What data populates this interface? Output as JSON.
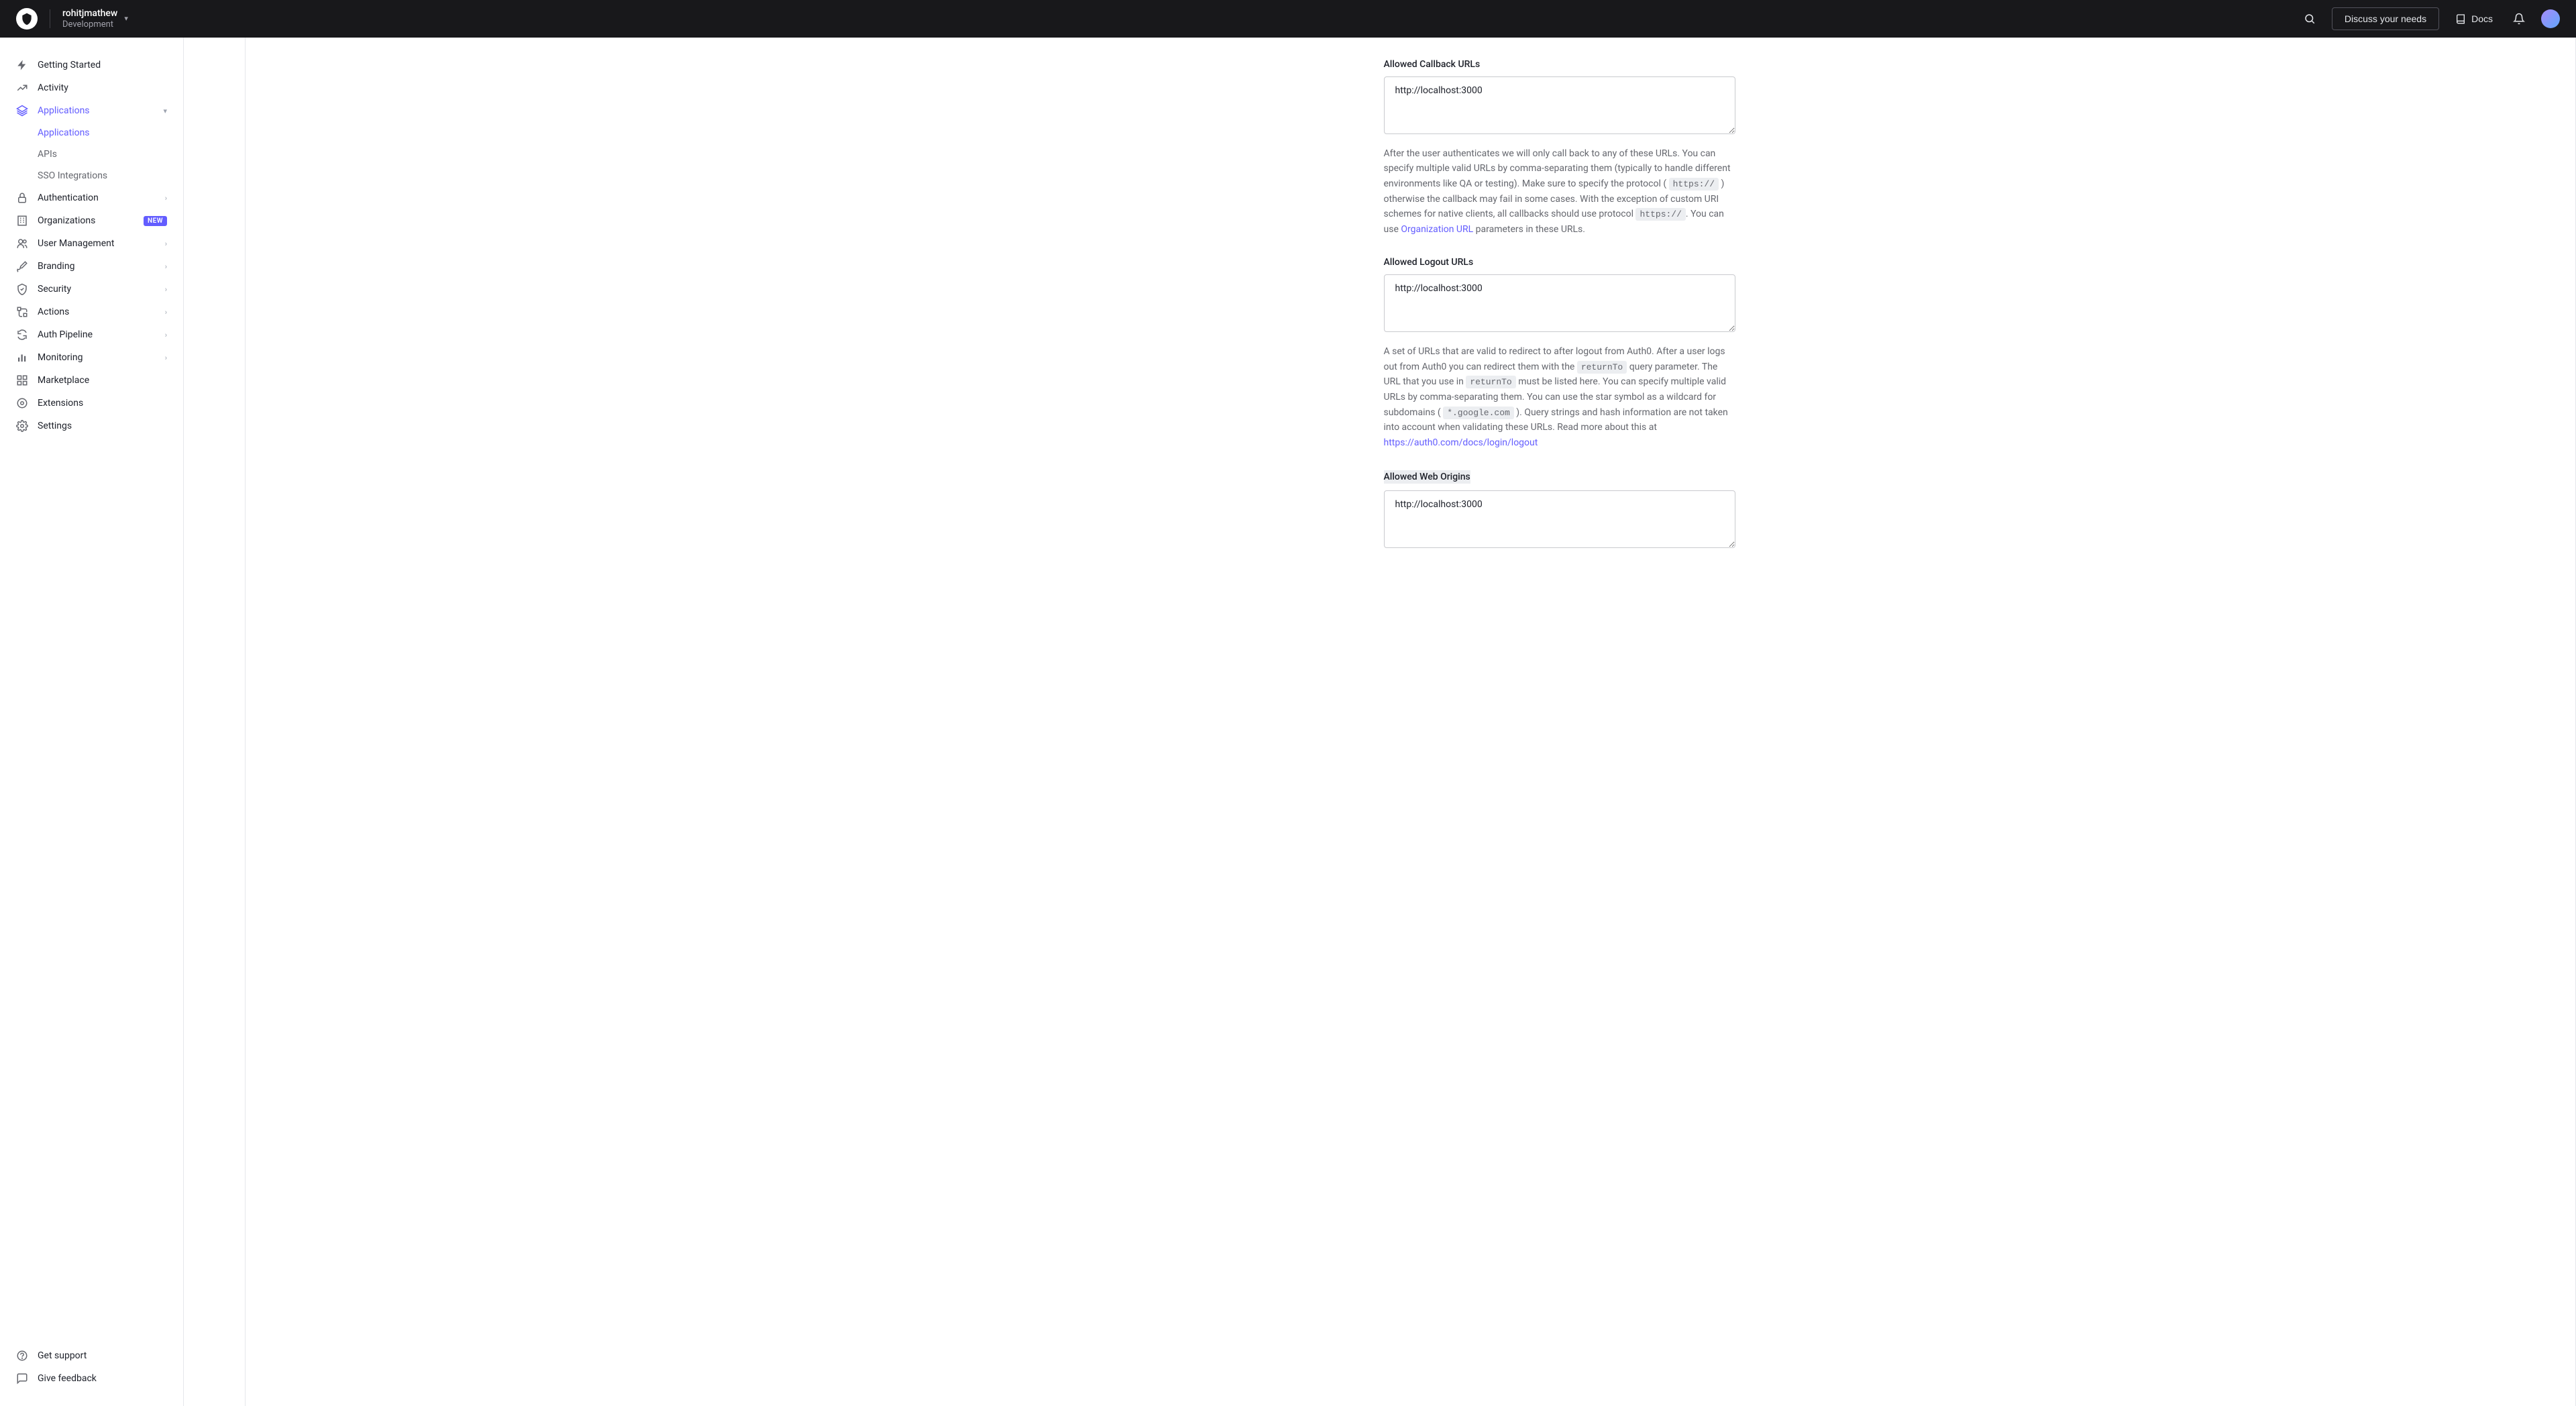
{
  "header": {
    "tenant_name": "rohitjmathew",
    "tenant_env": "Development",
    "discuss_label": "Discuss your needs",
    "docs_label": "Docs"
  },
  "sidebar": {
    "items": [
      {
        "label": "Getting Started",
        "icon": "lightning"
      },
      {
        "label": "Activity",
        "icon": "chart"
      },
      {
        "label": "Applications",
        "icon": "layers",
        "active": true,
        "expanded": true
      },
      {
        "label": "Authentication",
        "icon": "lock",
        "chevron": true
      },
      {
        "label": "Organizations",
        "icon": "building",
        "badge": "NEW"
      },
      {
        "label": "User Management",
        "icon": "users",
        "chevron": true
      },
      {
        "label": "Branding",
        "icon": "brush",
        "chevron": true
      },
      {
        "label": "Security",
        "icon": "shield",
        "chevron": true
      },
      {
        "label": "Actions",
        "icon": "flow",
        "chevron": true
      },
      {
        "label": "Auth Pipeline",
        "icon": "pipeline",
        "chevron": true
      },
      {
        "label": "Monitoring",
        "icon": "bars",
        "chevron": true
      },
      {
        "label": "Marketplace",
        "icon": "grid"
      },
      {
        "label": "Extensions",
        "icon": "puzzle"
      },
      {
        "label": "Settings",
        "icon": "gear"
      }
    ],
    "sub_items": [
      {
        "label": "Applications",
        "active": true
      },
      {
        "label": "APIs"
      },
      {
        "label": "SSO Integrations"
      }
    ],
    "footer": [
      {
        "label": "Get support",
        "icon": "help"
      },
      {
        "label": "Give feedback",
        "icon": "message"
      }
    ]
  },
  "form": {
    "callback": {
      "label": "Allowed Callback URLs",
      "value": "http://localhost:3000",
      "help_pre": "After the user authenticates we will only call back to any of these URLs. You can specify multiple valid URLs by comma-separating them (typically to handle different environments like QA or testing). Make sure to specify the protocol (",
      "code1": "https://",
      "help_mid1": ") otherwise the callback may fail in some cases. With the exception of custom URI schemes for native clients, all callbacks should use protocol ",
      "code2": "https://",
      "help_mid2": ". You can use ",
      "link_text": "Organization URL",
      "help_post": " parameters in these URLs."
    },
    "logout": {
      "label": "Allowed Logout URLs",
      "value": "http://localhost:3000",
      "help_pre": "A set of URLs that are valid to redirect to after logout from Auth0. After a user logs out from Auth0 you can redirect them with the ",
      "code1": "returnTo",
      "help_mid1": " query parameter. The URL that you use in ",
      "code2": "returnTo",
      "help_mid2": " must be listed here. You can specify multiple valid URLs by comma-separating them. You can use the star symbol as a wildcard for subdomains ( ",
      "code3": "*.google.com",
      "help_mid3": " ). Query strings and hash information are not taken into account when validating these URLs. Read more about this at ",
      "link_text": "https://auth0.com/docs/login/logout"
    },
    "origins": {
      "label": "Allowed Web Origins",
      "value": "http://localhost:3000"
    }
  }
}
